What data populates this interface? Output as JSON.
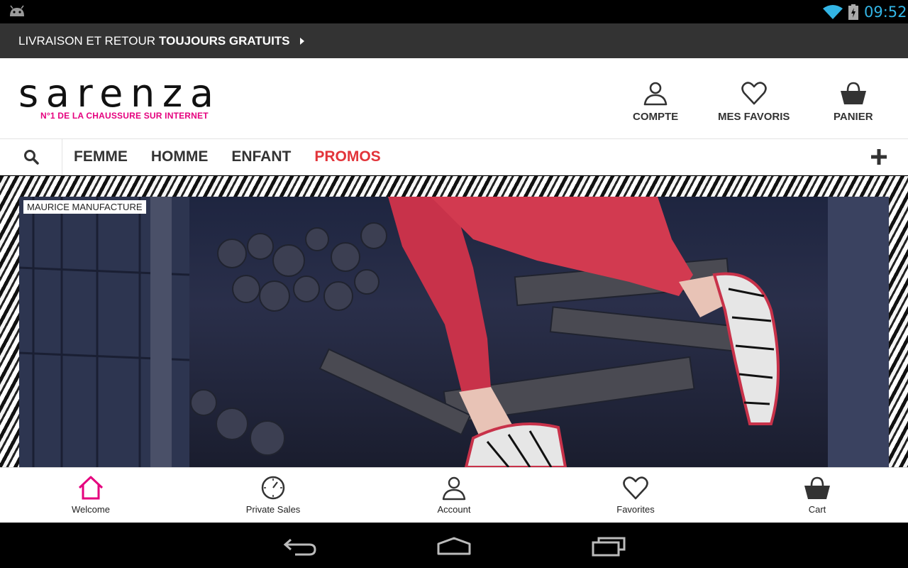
{
  "status_bar": {
    "time": "09:52",
    "icons": [
      "android-icon",
      "wifi-icon",
      "battery-icon"
    ],
    "clock_color": "#33b5e5"
  },
  "promo_bar": {
    "text_normal": "LIVRAISON ET RETOUR",
    "text_bold": "TOUJOURS GRATUITS",
    "icon": "arrow-right-icon"
  },
  "header": {
    "logo_text": "SARENZA",
    "tagline": "N°1 DE LA CHAUSSURE SUR INTERNET",
    "actions": [
      {
        "label": "COMPTE",
        "icon": "user-icon"
      },
      {
        "label": "MES FAVORIS",
        "icon": "heart-icon"
      },
      {
        "label": "PANIER",
        "icon": "basket-icon"
      }
    ]
  },
  "nav": {
    "search_icon": "search-icon",
    "items": [
      {
        "label": "FEMME"
      },
      {
        "label": "HOMME"
      },
      {
        "label": "ENFANT"
      },
      {
        "label": "PROMOS",
        "color": "#e2343a"
      }
    ],
    "more_icon": "plus-icon"
  },
  "hero": {
    "brand_tag": "MAURICE MANUFACTURE"
  },
  "tabbar": {
    "tabs": [
      {
        "label": "Welcome",
        "icon": "home-icon",
        "active": true,
        "color": "#e5007e"
      },
      {
        "label": "Private Sales",
        "icon": "clock-icon"
      },
      {
        "label": "Account",
        "icon": "user-icon"
      },
      {
        "label": "Favorites",
        "icon": "heart-icon"
      },
      {
        "label": "Cart",
        "icon": "basket-icon"
      }
    ]
  },
  "system_nav": {
    "buttons": [
      "back-icon",
      "home-nav-icon",
      "recent-apps-icon"
    ]
  },
  "colors": {
    "brand_pink": "#e5007e",
    "promo_red": "#e2343a",
    "promo_bar_bg": "#333333"
  }
}
